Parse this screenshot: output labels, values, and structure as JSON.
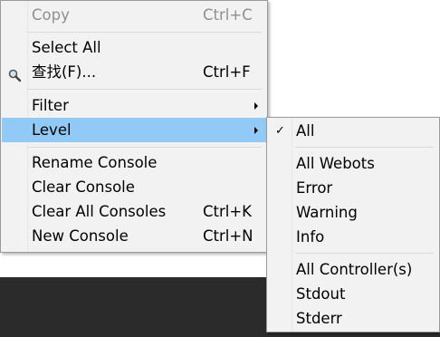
{
  "main_menu": {
    "copy": {
      "label": "Copy",
      "shortcut": "Ctrl+C"
    },
    "select_all": {
      "label": "Select All"
    },
    "find": {
      "label": "查找(F)...",
      "shortcut": "Ctrl+F",
      "icon": "search-icon"
    },
    "filter": {
      "label": "Filter"
    },
    "level": {
      "label": "Level"
    },
    "rename_console": {
      "label": "Rename Console"
    },
    "clear_console": {
      "label": "Clear Console"
    },
    "clear_all_consoles": {
      "label": "Clear All Consoles",
      "shortcut": "Ctrl+K"
    },
    "new_console": {
      "label": "New Console",
      "shortcut": "Ctrl+N"
    }
  },
  "level_submenu": {
    "check_glyph": "✓",
    "all": {
      "label": "All",
      "checked": true
    },
    "all_webots": {
      "label": "All Webots"
    },
    "error": {
      "label": "Error"
    },
    "warning": {
      "label": "Warning"
    },
    "info": {
      "label": "Info"
    },
    "all_controllers": {
      "label": "All Controller(s)"
    },
    "stdout": {
      "label": "Stdout"
    },
    "stderr": {
      "label": "Stderr"
    }
  },
  "colors": {
    "menu_bg": "#f2f2f2",
    "highlight": "#91c9f7",
    "disabled_text": "#8f8f8f",
    "background_dark": "#2b2b2b"
  }
}
